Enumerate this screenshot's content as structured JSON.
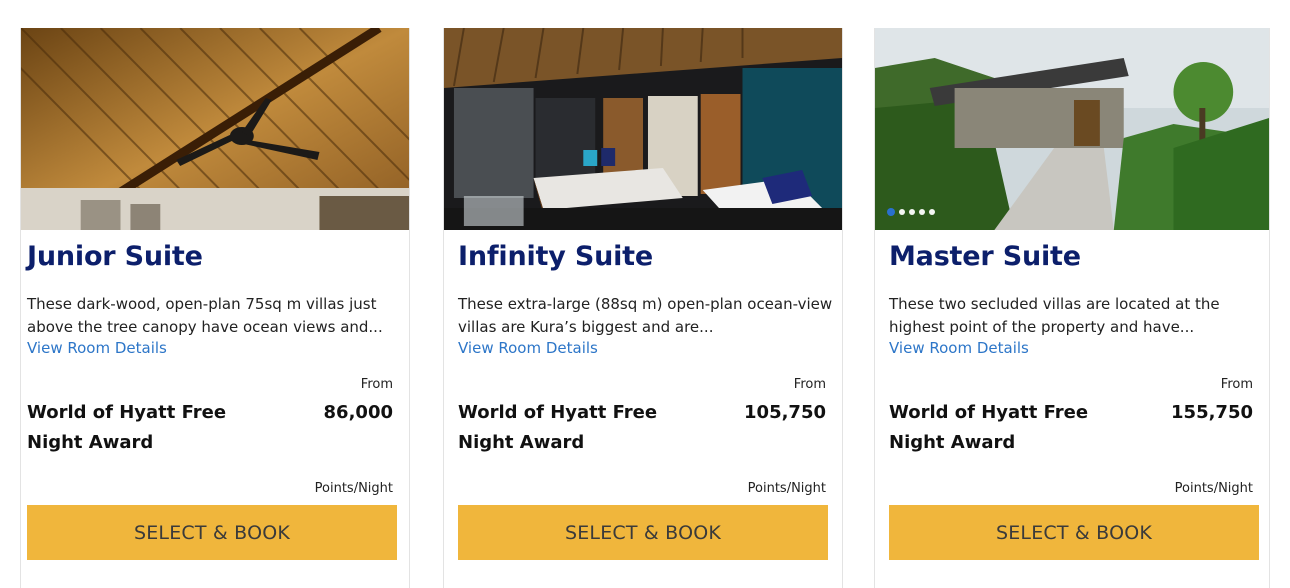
{
  "cards": [
    {
      "title": "Junior Suite",
      "description": "These dark-wood, open-plan 75sq m villas just above the tree canopy have ocean views and...",
      "link": "View Room Details",
      "from": "From",
      "award": "World of Hyatt Free Night Award",
      "points": "86,000",
      "unit": "Points/Night",
      "button": "SELECT & BOOK"
    },
    {
      "title": "Infinity Suite",
      "description": "These extra-large (88sq m) open-plan ocean-view villas are Kura’s biggest and are...",
      "link": "View Room Details",
      "from": "From",
      "award": "World of Hyatt Free Night Award",
      "points": "105,750",
      "unit": "Points/Night",
      "button": "SELECT & BOOK"
    },
    {
      "title": "Master Suite",
      "description": "These two secluded villas are located at the highest point of the property and have...",
      "link": "View Room Details",
      "from": "From",
      "award": "World of Hyatt Free Night Award",
      "points": "155,750",
      "unit": "Points/Night",
      "button": "SELECT & BOOK"
    }
  ],
  "carousel": {
    "count": 5,
    "active": 1
  },
  "colors": {
    "title": "#0c1f6b",
    "link": "#2d76c8",
    "button": "#f0b63c"
  }
}
